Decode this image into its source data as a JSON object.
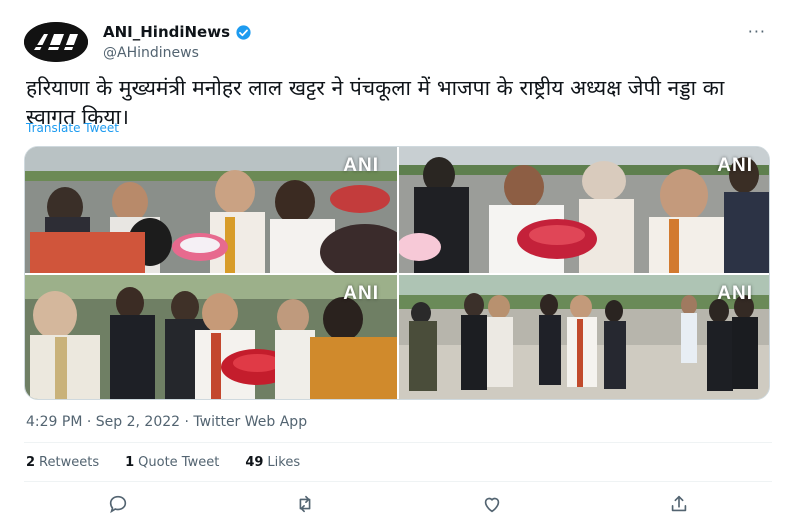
{
  "tweet": {
    "display_name": "ANI_HindiNews",
    "handle": "@AHindinews",
    "verified_icon": "verified-badge-icon",
    "more_label": "···",
    "text": "हरियाणा के मुख्यमंत्री मनोहर लाल खट्टर ने पंचकूला में भाजपा के राष्ट्रीय अध्यक्ष जेपी नड्डा का स्वागत किया।",
    "translate_label": "Translate Tweet",
    "media": [
      {
        "watermark": "ANI"
      },
      {
        "watermark": "ANI"
      },
      {
        "watermark": "ANI"
      },
      {
        "watermark": "ANI"
      }
    ],
    "timestamp": "4:29 PM · Sep 2, 2022 · Twitter Web App",
    "stats": {
      "retweets_count": "2",
      "retweets_label": "Retweets",
      "quotes_count": "1",
      "quotes_label": "Quote Tweet",
      "likes_count": "49",
      "likes_label": "Likes"
    },
    "actions": [
      "reply-icon",
      "retweet-icon",
      "like-icon",
      "share-icon"
    ]
  },
  "colors": {
    "accent": "#1d9bf0",
    "text_primary": "#0f1419",
    "text_secondary": "#536471",
    "border": "#eff3f4"
  }
}
